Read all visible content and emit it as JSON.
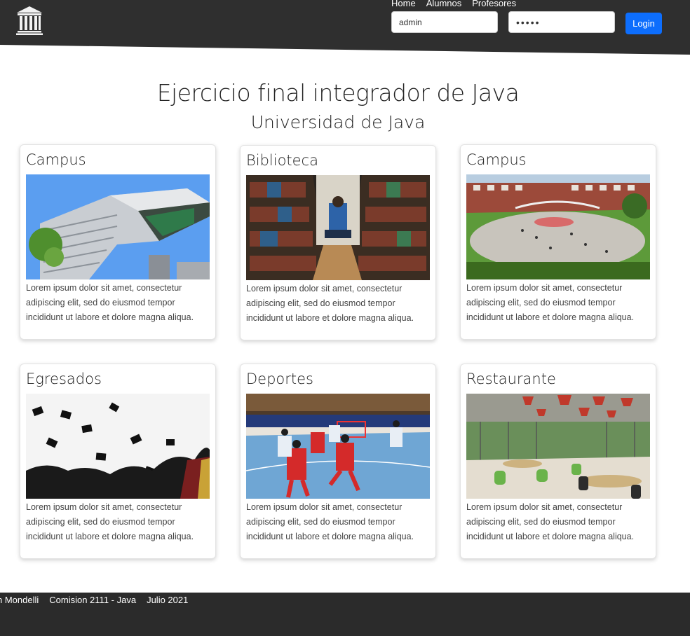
{
  "colors": {
    "header": "#2f2f2f",
    "footer": "#2b2b2b",
    "primary": "#0d6efd"
  },
  "nav": {
    "items": [
      "Home",
      "Alumnos",
      "Profesores"
    ]
  },
  "login": {
    "user_value": "admin",
    "password_value": "•••••",
    "button_label": "Login"
  },
  "main": {
    "title": "Ejercicio final integrador de Java",
    "subtitle": "Universidad de Java"
  },
  "cards": [
    {
      "title": "Campus",
      "text": "Lorem ipsum dolor sit amet, consectetur adipiscing elit, sed do eiusmod tempor incididunt ut labore et dolore magna aliqua.",
      "image": "modern-building-photo"
    },
    {
      "title": "Biblioteca",
      "text": "Lorem ipsum dolor sit amet, consectetur adipiscing elit, sed do eiusmod tempor incididunt ut labore et dolore magna aliqua.",
      "image": "library-photo"
    },
    {
      "title": "Campus",
      "text": "Lorem ipsum dolor sit amet, consectetur adipiscing elit, sed do eiusmod tempor incididunt ut labore et dolore magna aliqua.",
      "image": "campus-plaza-photo"
    },
    {
      "title": "Egresados",
      "text": "Lorem ipsum dolor sit amet, consectetur adipiscing elit, sed do eiusmod tempor incididunt ut labore et dolore magna aliqua.",
      "image": "graduation-photo"
    },
    {
      "title": "Deportes",
      "text": "Lorem ipsum dolor sit amet, consectetur adipiscing elit, sed do eiusmod tempor incididunt ut labore et dolore magna aliqua.",
      "image": "handball-photo"
    },
    {
      "title": "Restaurante",
      "text": "Lorem ipsum dolor sit amet, consectetur adipiscing elit, sed do eiusmod tempor incididunt ut labore et dolore magna aliqua.",
      "image": "restaurant-photo"
    }
  ],
  "footer": {
    "items": [
      "stin Mondelli",
      "Comision 2111 - Java",
      "Julio 2021"
    ]
  }
}
